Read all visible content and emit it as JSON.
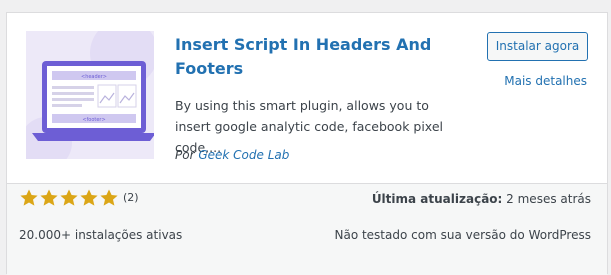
{
  "plugin": {
    "title": "Insert Script In Headers And Footers",
    "description": "By using this smart plugin, allows you to insert google analytic code, facebook pixel code,...",
    "author_prefix": "Por",
    "author_name": "Geek Code Lab",
    "thumbnail": {
      "header_label": "<header>",
      "footer_label": "<footer>",
      "icon": "laptop-webpage-icon"
    }
  },
  "actions": {
    "install_label": "Instalar agora",
    "details_label": "Mais detalhes"
  },
  "footer": {
    "rating": {
      "stars": 5,
      "max_stars": 5,
      "count_text": "(2)"
    },
    "installs_text": "20.000+ instalações ativas",
    "last_updated_label": "Última atualização:",
    "last_updated_value": "2 meses atrás",
    "compatibility_text": "Não testado com sua versão do WordPress"
  },
  "colors": {
    "link": "#2271b1",
    "text": "#3c434a",
    "star": "#dba617",
    "thumb_bg": "#ede9f8",
    "thumb_purple": "#6d5ed5"
  }
}
